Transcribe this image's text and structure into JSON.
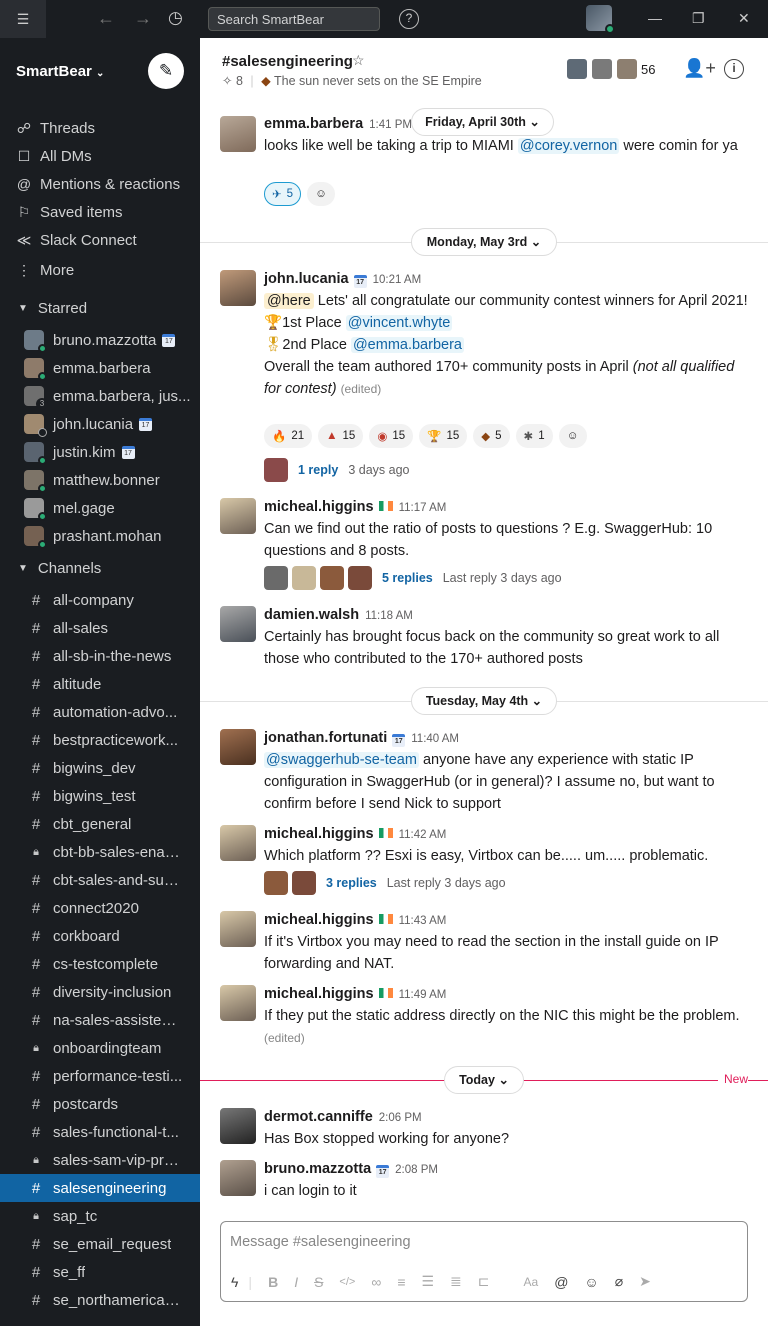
{
  "topbar": {
    "search_placeholder": "Search SmartBear",
    "menu_icon": "hamburger-icon",
    "help": "?"
  },
  "sidebar": {
    "workspace": "SmartBear",
    "nav": [
      {
        "label": "Threads",
        "icon": "threads-icon"
      },
      {
        "label": "All DMs",
        "icon": "dms-icon"
      },
      {
        "label": "Mentions & reactions",
        "icon": "at-icon"
      },
      {
        "label": "Saved items",
        "icon": "bookmark-icon"
      },
      {
        "label": "Slack Connect",
        "icon": "connect-icon"
      },
      {
        "label": "More",
        "icon": "more-icon"
      }
    ],
    "starred_header": "Starred",
    "starred": [
      {
        "label": "bruno.mazzotta"
      },
      {
        "label": "emma.barbera"
      },
      {
        "label": "emma.barbera, jus..."
      },
      {
        "label": "john.lucania"
      },
      {
        "label": "justin.kim"
      },
      {
        "label": "matthew.bonner"
      },
      {
        "label": "mel.gage"
      },
      {
        "label": "prashant.mohan"
      }
    ],
    "channels_header": "Channels",
    "channels": [
      {
        "label": "all-company",
        "private": false
      },
      {
        "label": "all-sales",
        "private": false
      },
      {
        "label": "all-sb-in-the-news",
        "private": false
      },
      {
        "label": "altitude",
        "private": false
      },
      {
        "label": "automation-advo...",
        "private": false
      },
      {
        "label": "bestpracticework...",
        "private": false
      },
      {
        "label": "bigwins_dev",
        "private": false
      },
      {
        "label": "bigwins_test",
        "private": false
      },
      {
        "label": "cbt_general",
        "private": false
      },
      {
        "label": "cbt-bb-sales-enab...",
        "private": true
      },
      {
        "label": "cbt-sales-and-sup...",
        "private": false
      },
      {
        "label": "connect2020",
        "private": false
      },
      {
        "label": "corkboard",
        "private": false
      },
      {
        "label": "cs-testcomplete",
        "private": false
      },
      {
        "label": "diversity-inclusion",
        "private": false
      },
      {
        "label": "na-sales-assisted-...",
        "private": false
      },
      {
        "label": "onboardingteam",
        "private": true
      },
      {
        "label": "performance-testi...",
        "private": false
      },
      {
        "label": "postcards",
        "private": false
      },
      {
        "label": "sales-functional-t...",
        "private": false
      },
      {
        "label": "sales-sam-vip-pre...",
        "private": true
      },
      {
        "label": "salesengineering",
        "private": false,
        "active": true
      },
      {
        "label": "sap_tc",
        "private": true
      },
      {
        "label": "se_email_request",
        "private": false
      },
      {
        "label": "se_ff",
        "private": false
      },
      {
        "label": "se_northamerica_...",
        "private": false
      }
    ]
  },
  "header": {
    "channel": "#salesengineering",
    "pins": "8",
    "topic": "The sun never sets on the SE Empire",
    "members": "56"
  },
  "dates": {
    "d1": "Friday, April 30th",
    "d2": "Monday, May 3rd",
    "d3": "Tuesday, May 4th",
    "d4": "Today",
    "new": "New"
  },
  "messages": {
    "m1": {
      "name": "emma.barbera",
      "time": "1:41 PM",
      "text_a": "looks like well be taking a trip to MIAMI ",
      "mention": "@corey.vernon",
      "text_b": " were comin for ya",
      "react_count": "5"
    },
    "m2": {
      "name": "john.lucania",
      "time": "10:21 AM",
      "here": "@here",
      "text1": " Lets' all congratulate our community contest winners for April 2021!",
      "first": "1st Place ",
      "first_mention": "@vincent.whyte",
      "second": "2nd Place ",
      "second_mention": "@emma.barbera",
      "text2": "Overall the team authored 170+ community posts in April ",
      "italic": "(not all qualified for contest)",
      "edited": "(edited)",
      "reactions": [
        "21",
        "15",
        "15",
        "15",
        "5",
        "1"
      ],
      "replies": "1 reply",
      "last": "3 days ago"
    },
    "m3": {
      "name": "micheal.higgins",
      "time": "11:17 AM",
      "text": "Can we find out the ratio of posts to questions ? E.g. SwaggerHub: 10 questions and 8 posts.",
      "replies": "5 replies",
      "last": "Last reply 3 days ago"
    },
    "m4": {
      "name": "damien.walsh",
      "time": "11:18 AM",
      "text": "Certainly has brought focus back on the community so great work to all those who contributed to the 170+ authored posts"
    },
    "m5": {
      "name": "jonathan.fortunati",
      "time": "11:40 AM",
      "mention": "@swaggerhub-se-team",
      "text": " anyone have any experience with static IP configuration in SwaggerHub (or in general)? I assume no, but want to confirm before I send Nick to support"
    },
    "m6": {
      "name": "micheal.higgins",
      "time": "11:42 AM",
      "text": "Which platform ?? Esxi is easy, Virtbox can be..... um..... problematic.",
      "replies": "3 replies",
      "last": "Last reply 3 days ago"
    },
    "m7": {
      "name": "micheal.higgins",
      "time": "11:43 AM",
      "text": "If it's Virtbox you may need to read the section in the install guide on IP forwarding and NAT."
    },
    "m8": {
      "name": "micheal.higgins",
      "time": "11:49 AM",
      "text": "If they put the static address directly on the NIC this might be the problem.",
      "edited": "(edited)"
    },
    "m9": {
      "name": "dermot.canniffe",
      "time": "2:06 PM",
      "text": "Has Box stopped working for anyone?"
    },
    "m10": {
      "name": "bruno.mazzotta",
      "time": "2:08 PM",
      "text": "i can login to it"
    }
  },
  "composer": {
    "placeholder": "Message #salesengineering"
  }
}
